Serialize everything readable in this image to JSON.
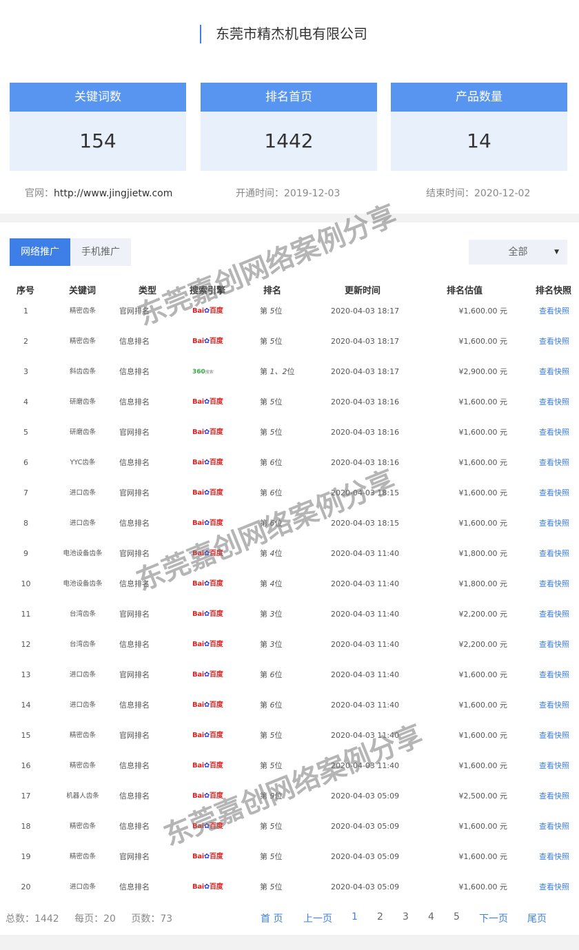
{
  "company": "东莞市精杰机电有限公司",
  "stats": [
    {
      "label": "关键词数",
      "value": "154"
    },
    {
      "label": "排名首页",
      "value": "1442"
    },
    {
      "label": "产品数量",
      "value": "14"
    }
  ],
  "meta": {
    "site_label": "官网：",
    "site_value": "http://www.jingjietw.com",
    "open_label": "开通时间：",
    "open_value": "2019-12-03",
    "end_label": "结束时间：",
    "end_value": "2020-12-02"
  },
  "tabs": {
    "web": "网络推广",
    "mobile": "手机推广"
  },
  "filter": {
    "selected": "全部"
  },
  "columns": {
    "idx": "序号",
    "kw": "关键词",
    "type": "类型",
    "engine": "搜索引擎",
    "rank": "排名",
    "time": "更新时间",
    "price": "排名估值",
    "snap": "排名快照"
  },
  "engines": {
    "baidu": {
      "name": "Bai",
      "suffix": "百度",
      "icon": "baidu-paw-icon"
    },
    "so360": {
      "name": "360",
      "suffix": "搜索"
    }
  },
  "rows": [
    {
      "idx": "1",
      "kw": "精密齿条",
      "type": "官网排名",
      "engine": "baidu",
      "rank_pre": "第",
      "rank": "5",
      "rank_post": "位",
      "time": "2020-04-03 18:17",
      "price": "¥1,600.00 元",
      "snap": "查看快照"
    },
    {
      "idx": "2",
      "kw": "精密齿条",
      "type": "信息排名",
      "engine": "baidu",
      "rank_pre": "第",
      "rank": "5",
      "rank_post": "位",
      "time": "2020-04-03 18:17",
      "price": "¥1,600.00 元",
      "snap": "查看快照"
    },
    {
      "idx": "3",
      "kw": "斜齿齿条",
      "type": "信息排名",
      "engine": "so360",
      "rank_pre": "第",
      "rank": "1、2",
      "rank_post": "位",
      "time": "2020-04-03 18:17",
      "price": "¥2,900.00 元",
      "snap": "查看快照"
    },
    {
      "idx": "4",
      "kw": "研磨齿条",
      "type": "信息排名",
      "engine": "baidu",
      "rank_pre": "第",
      "rank": "5",
      "rank_post": "位",
      "time": "2020-04-03 18:16",
      "price": "¥1,600.00 元",
      "snap": "查看快照"
    },
    {
      "idx": "5",
      "kw": "研磨齿条",
      "type": "官网排名",
      "engine": "baidu",
      "rank_pre": "第",
      "rank": "5",
      "rank_post": "位",
      "time": "2020-04-03 18:16",
      "price": "¥1,600.00 元",
      "snap": "查看快照"
    },
    {
      "idx": "6",
      "kw": "YYC齿条",
      "type": "信息排名",
      "engine": "baidu",
      "rank_pre": "第",
      "rank": "6",
      "rank_post": "位",
      "time": "2020-04-03 18:16",
      "price": "¥1,600.00 元",
      "snap": "查看快照"
    },
    {
      "idx": "7",
      "kw": "进口齿条",
      "type": "官网排名",
      "engine": "baidu",
      "rank_pre": "第",
      "rank": "6",
      "rank_post": "位",
      "time": "2020-04-03 18:15",
      "price": "¥1,600.00 元",
      "snap": "查看快照"
    },
    {
      "idx": "8",
      "kw": "进口齿条",
      "type": "信息排名",
      "engine": "baidu",
      "rank_pre": "第",
      "rank": "6",
      "rank_post": "位",
      "time": "2020-04-03 18:15",
      "price": "¥1,600.00 元",
      "snap": "查看快照"
    },
    {
      "idx": "9",
      "kw": "电池设备齿条",
      "type": "官网排名",
      "engine": "baidu",
      "rank_pre": "第",
      "rank": "4",
      "rank_post": "位",
      "time": "2020-04-03 11:40",
      "price": "¥1,800.00 元",
      "snap": "查看快照"
    },
    {
      "idx": "10",
      "kw": "电池设备齿条",
      "type": "信息排名",
      "engine": "baidu",
      "rank_pre": "第",
      "rank": "4",
      "rank_post": "位",
      "time": "2020-04-03 11:40",
      "price": "¥1,800.00 元",
      "snap": "查看快照"
    },
    {
      "idx": "11",
      "kw": "台湾齿条",
      "type": "官网排名",
      "engine": "baidu",
      "rank_pre": "第",
      "rank": "3",
      "rank_post": "位",
      "time": "2020-04-03 11:40",
      "price": "¥2,200.00 元",
      "snap": "查看快照"
    },
    {
      "idx": "12",
      "kw": "台湾齿条",
      "type": "信息排名",
      "engine": "baidu",
      "rank_pre": "第",
      "rank": "3",
      "rank_post": "位",
      "time": "2020-04-03 11:40",
      "price": "¥2,200.00 元",
      "snap": "查看快照"
    },
    {
      "idx": "13",
      "kw": "进口齿条",
      "type": "官网排名",
      "engine": "baidu",
      "rank_pre": "第",
      "rank": "6",
      "rank_post": "位",
      "time": "2020-04-03 11:40",
      "price": "¥1,600.00 元",
      "snap": "查看快照"
    },
    {
      "idx": "14",
      "kw": "进口齿条",
      "type": "信息排名",
      "engine": "baidu",
      "rank_pre": "第",
      "rank": "6",
      "rank_post": "位",
      "time": "2020-04-03 11:40",
      "price": "¥1,600.00 元",
      "snap": "查看快照"
    },
    {
      "idx": "15",
      "kw": "精密齿条",
      "type": "官网排名",
      "engine": "baidu",
      "rank_pre": "第",
      "rank": "5",
      "rank_post": "位",
      "time": "2020-04-03 11:40",
      "price": "¥1,600.00 元",
      "snap": "查看快照"
    },
    {
      "idx": "16",
      "kw": "精密齿条",
      "type": "信息排名",
      "engine": "baidu",
      "rank_pre": "第",
      "rank": "5",
      "rank_post": "位",
      "time": "2020-04-03 11:40",
      "price": "¥1,600.00 元",
      "snap": "查看快照"
    },
    {
      "idx": "17",
      "kw": "机器人齿条",
      "type": "信息排名",
      "engine": "baidu",
      "rank_pre": "第",
      "rank": "9",
      "rank_post": "位",
      "time": "2020-04-03 05:09",
      "price": "¥2,500.00 元",
      "snap": "查看快照"
    },
    {
      "idx": "18",
      "kw": "精密齿条",
      "type": "信息排名",
      "engine": "baidu",
      "rank_pre": "第",
      "rank": "5",
      "rank_post": "位",
      "time": "2020-04-03 05:09",
      "price": "¥1,600.00 元",
      "snap": "查看快照"
    },
    {
      "idx": "19",
      "kw": "精密齿条",
      "type": "官网排名",
      "engine": "baidu",
      "rank_pre": "第",
      "rank": "5",
      "rank_post": "位",
      "time": "2020-04-03 05:09",
      "price": "¥1,600.00 元",
      "snap": "查看快照"
    },
    {
      "idx": "20",
      "kw": "进口齿条",
      "type": "信息排名",
      "engine": "baidu",
      "rank_pre": "第",
      "rank": "5",
      "rank_post": "位",
      "time": "2020-04-03 05:09",
      "price": "¥1,600.00 元",
      "snap": "查看快照"
    }
  ],
  "pager": {
    "total": "总数：1442",
    "per_page": "每页：20",
    "pages": "页数：73",
    "first": "首 页",
    "prev": "上一页",
    "nums": [
      "1",
      "2",
      "3",
      "4",
      "5"
    ],
    "next": "下一页",
    "last": "尾页"
  },
  "watermark": "东莞嘉创网络案例分享",
  "colors": {
    "accent": "#3d7fe6",
    "card_head": "#5795f0",
    "card_body": "#e8f0fb"
  }
}
